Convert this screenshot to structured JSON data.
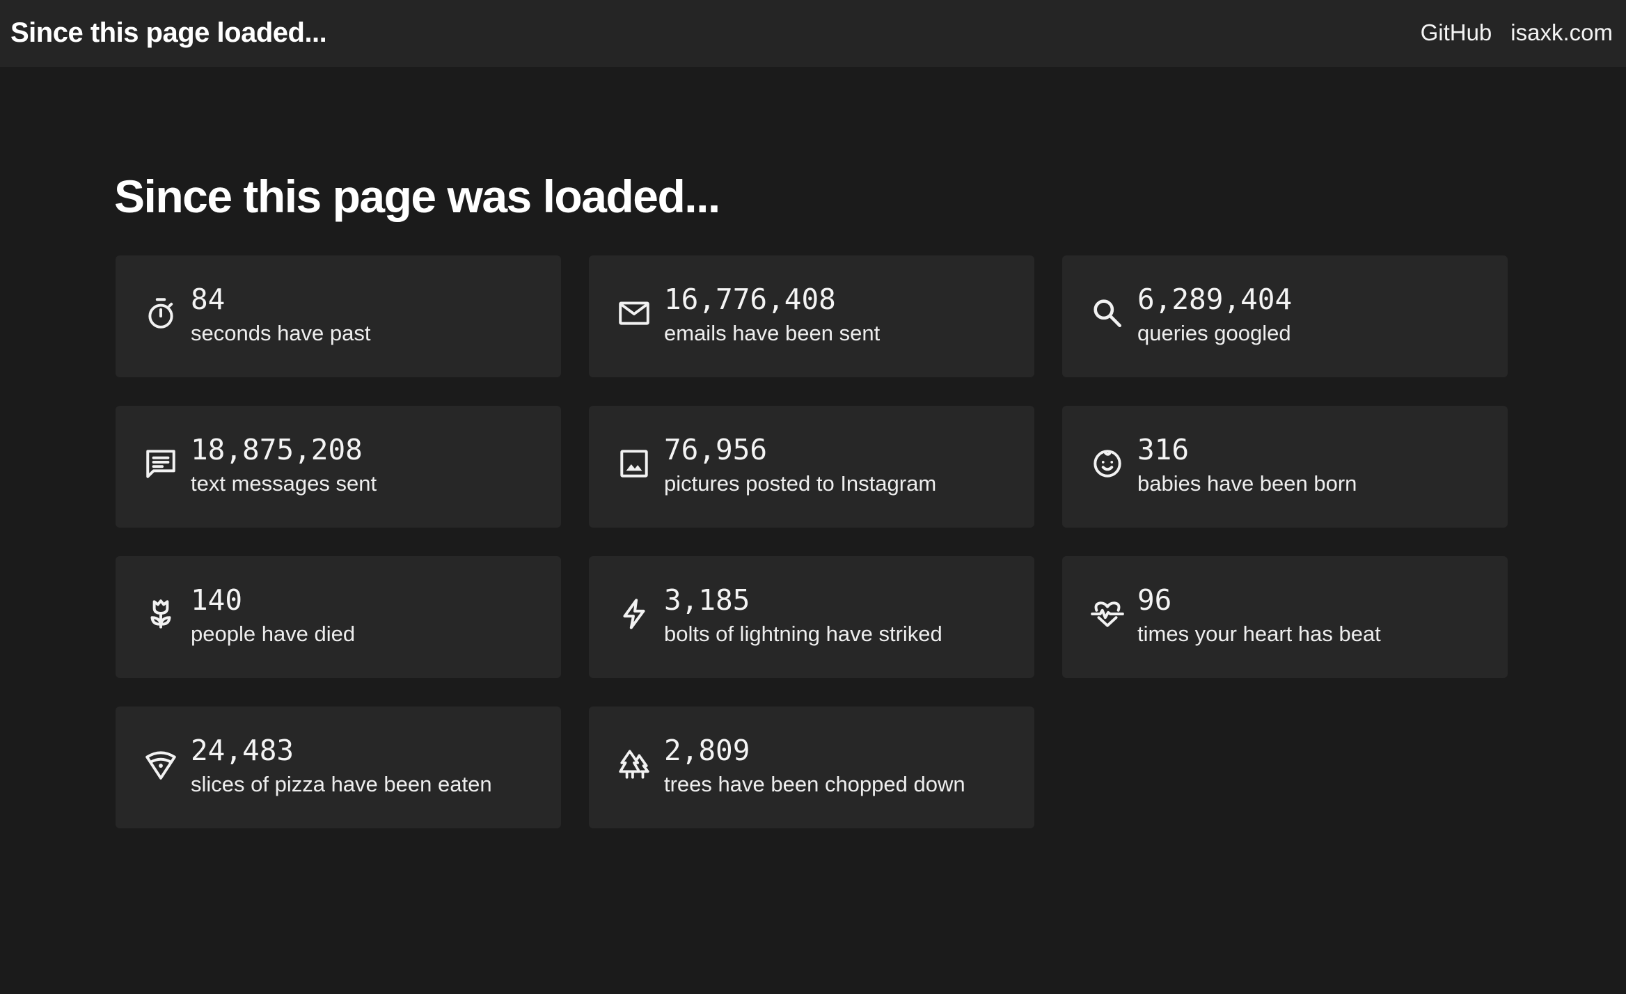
{
  "header": {
    "brand": "Since this page loaded...",
    "links": [
      {
        "label": "GitHub"
      },
      {
        "label": "isaxk.com"
      }
    ]
  },
  "main": {
    "title": "Since this page was loaded...",
    "stats": [
      {
        "icon": "timer-icon",
        "value": "84",
        "label": "seconds have past"
      },
      {
        "icon": "mail-icon",
        "value": "16,776,408",
        "label": "emails have been sent"
      },
      {
        "icon": "search-icon",
        "value": "6,289,404",
        "label": "queries googled"
      },
      {
        "icon": "message-icon",
        "value": "18,875,208",
        "label": "text messages sent"
      },
      {
        "icon": "image-icon",
        "value": "76,956",
        "label": "pictures posted to Instagram"
      },
      {
        "icon": "baby-icon",
        "value": "316",
        "label": "babies have been born"
      },
      {
        "icon": "flower-icon",
        "value": "140",
        "label": "people have died"
      },
      {
        "icon": "lightning-icon",
        "value": "3,185",
        "label": "bolts of lightning have striked"
      },
      {
        "icon": "heartbeat-icon",
        "value": "96",
        "label": "times your heart has beat"
      },
      {
        "icon": "pizza-icon",
        "value": "24,483",
        "label": "slices of pizza have been eaten"
      },
      {
        "icon": "trees-icon",
        "value": "2,809",
        "label": "trees have been chopped down"
      }
    ]
  },
  "colors": {
    "background": "#1b1b1b",
    "topbar": "#252525",
    "card": "#272727",
    "text": "#f2f2f2"
  }
}
